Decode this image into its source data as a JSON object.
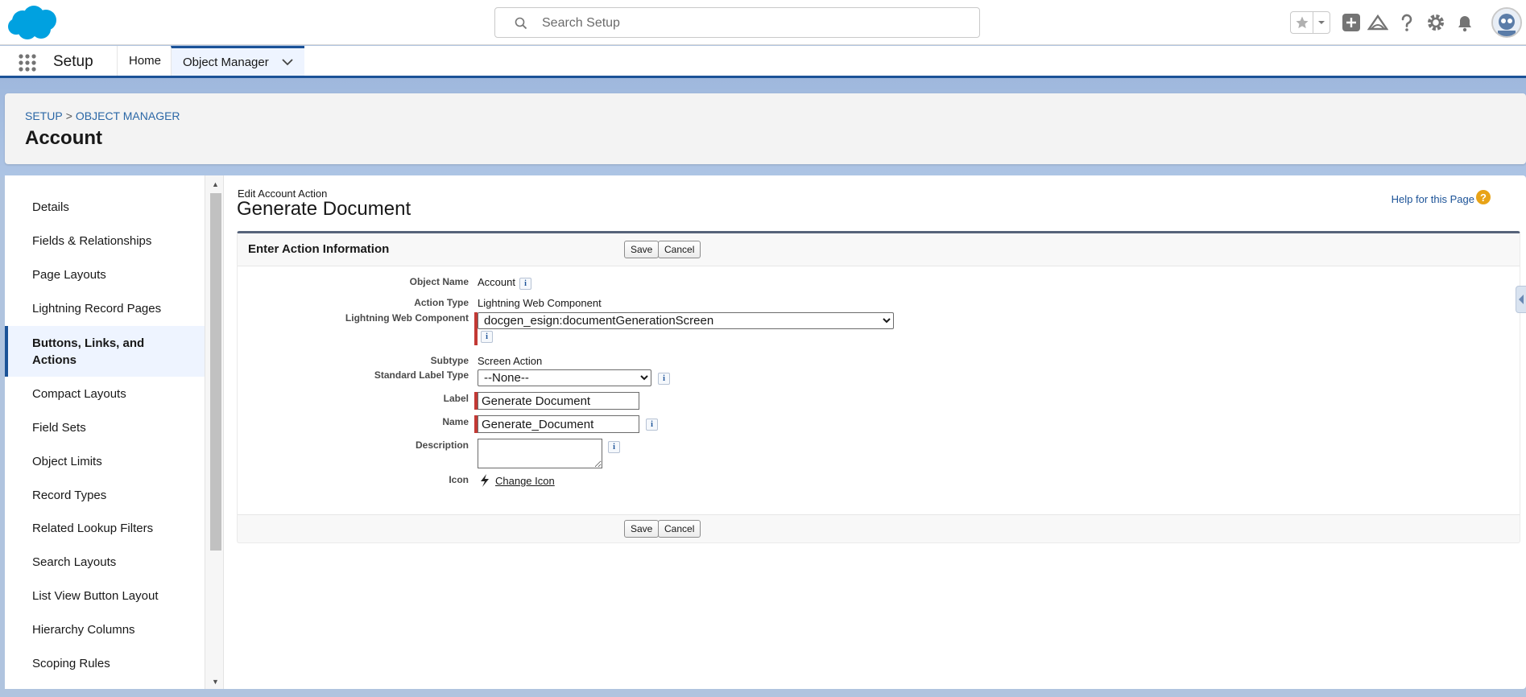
{
  "header": {
    "search_placeholder": "Search Setup"
  },
  "nav": {
    "app_name": "Setup",
    "tabs": [
      {
        "label": "Home"
      },
      {
        "label": "Object Manager"
      }
    ]
  },
  "page_header": {
    "breadcrumb": [
      "SETUP",
      "OBJECT MANAGER"
    ],
    "breadcrumb_separator": ">",
    "title": "Account"
  },
  "sidebar": {
    "items": [
      {
        "label": "Details"
      },
      {
        "label": "Fields & Relationships"
      },
      {
        "label": "Page Layouts"
      },
      {
        "label": "Lightning Record Pages"
      },
      {
        "label": "Buttons, Links, and"
      },
      {
        "label": "Actions"
      },
      {
        "label": "Compact Layouts"
      },
      {
        "label": "Field Sets"
      },
      {
        "label": "Object Limits"
      },
      {
        "label": "Record Types"
      },
      {
        "label": "Related Lookup Filters"
      },
      {
        "label": "Search Layouts"
      },
      {
        "label": "List View Button Layout"
      },
      {
        "label": "Hierarchy Columns"
      },
      {
        "label": "Scoping Rules"
      }
    ],
    "active": "Buttons, Links, and Actions"
  },
  "content": {
    "kicker": "Edit Account Action",
    "title": "Generate Document",
    "help_link": "Help for this Page",
    "help_icon": "?",
    "section_title": "Enter Action Information",
    "save_label": "Save",
    "cancel_label": "Cancel",
    "info_glyph": "i",
    "fields": {
      "object_name": {
        "label": "Object Name",
        "value": "Account"
      },
      "action_type": {
        "label": "Action Type",
        "value": "Lightning Web Component"
      },
      "lwc": {
        "label": "Lightning Web Component",
        "value": "docgen_esign:documentGenerationScreen"
      },
      "subtype": {
        "label": "Subtype",
        "value": "Screen Action"
      },
      "std_label_type": {
        "label": "Standard Label Type",
        "value": "--None--"
      },
      "label": {
        "label": "Label",
        "value": "Generate Document"
      },
      "name": {
        "label": "Name",
        "value": "Generate_Document"
      },
      "description": {
        "label": "Description",
        "value": ""
      },
      "icon": {
        "label": "Icon",
        "link": "Change Icon"
      }
    }
  },
  "colors": {
    "brand_blue": "#1b5297",
    "link_blue": "#2b67a6",
    "required_red": "#c23934",
    "active_bg": "#eef4ff"
  },
  "icons": [
    "salesforce-cloud-logo",
    "search-icon",
    "star-icon",
    "chevron-down-icon",
    "plus-icon",
    "trailhead-icon",
    "help-icon",
    "gear-icon",
    "bell-icon",
    "avatar",
    "app-launcher-icon",
    "info-icon",
    "lightning-bolt-icon"
  ]
}
